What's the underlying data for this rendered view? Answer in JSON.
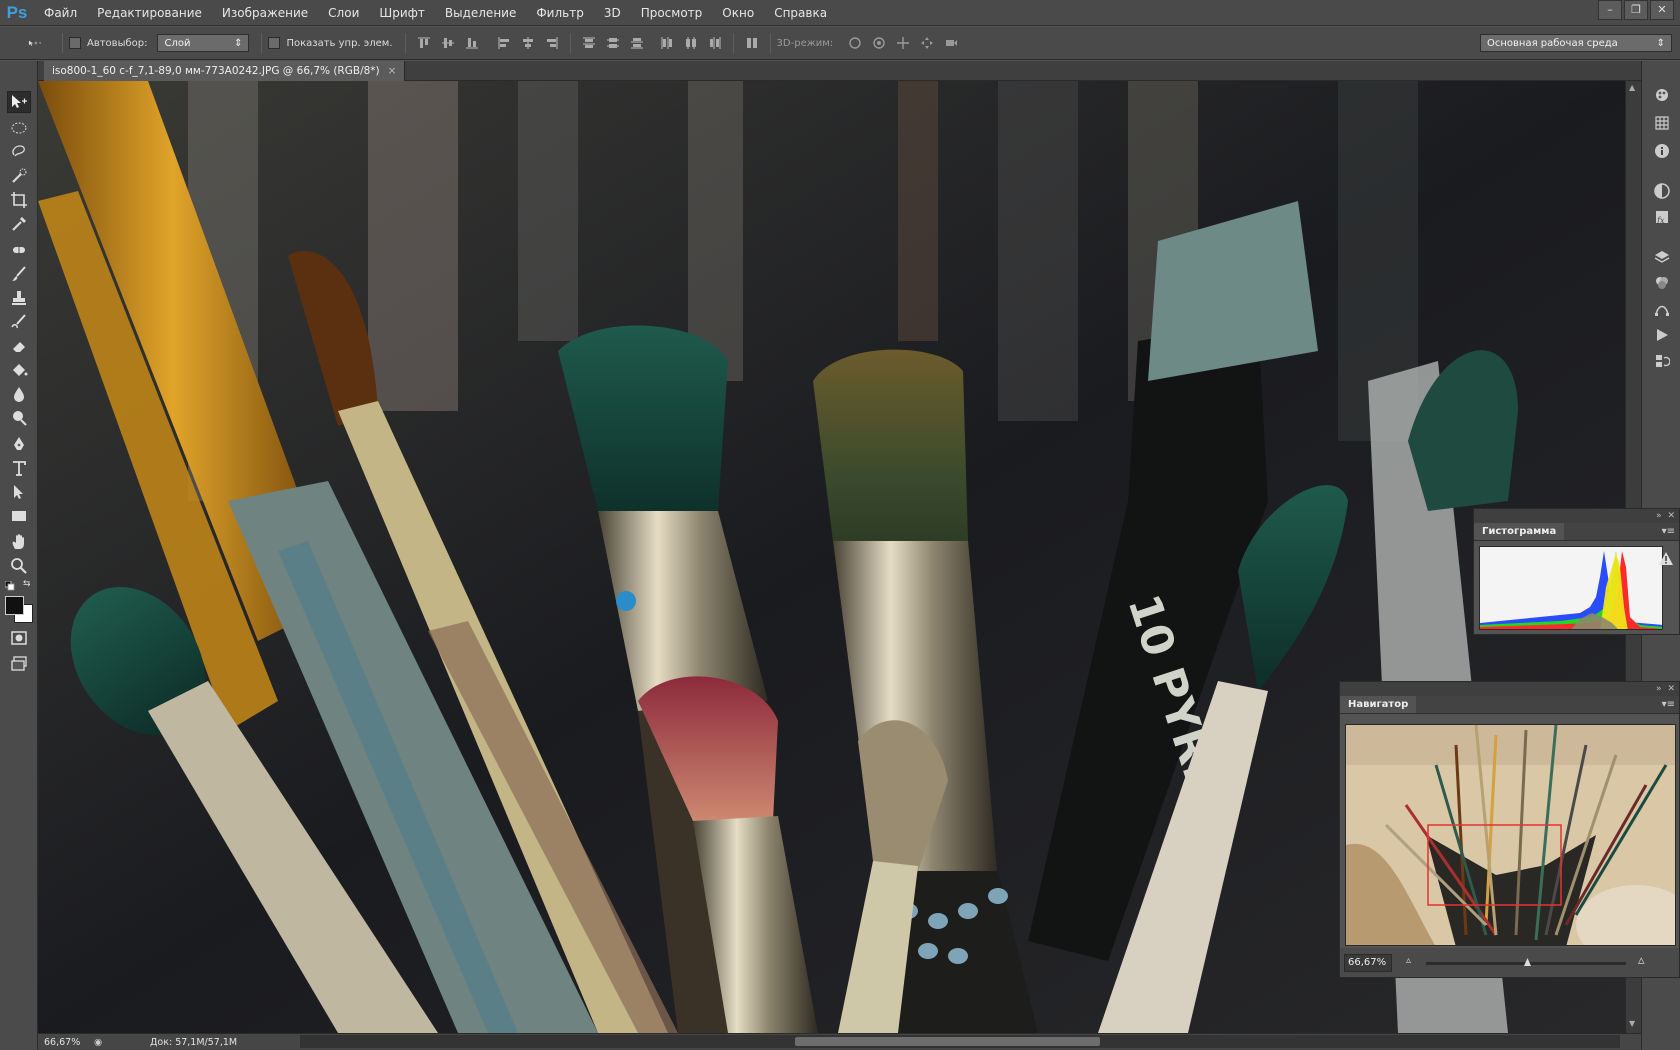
{
  "app": {
    "logo": "Ps"
  },
  "menu": [
    "Файл",
    "Редактирование",
    "Изображение",
    "Слои",
    "Шрифт",
    "Выделение",
    "Фильтр",
    "3D",
    "Просмотр",
    "Окно",
    "Справка"
  ],
  "options": {
    "autoselect_label": "Автовыбор:",
    "autoselect_value": "Слой",
    "show_transform_label": "Показать упр. элем.",
    "mode3d_label": "3D-режим:",
    "workspace_value": "Основная рабочая среда"
  },
  "document": {
    "tab_title": "iso800-1_60 с-f_7,1-89,0 мм-773A0242.JPG @ 66,7% (RGB/8*)",
    "close_glyph": "×"
  },
  "status": {
    "zoom": "66,67%",
    "doc_info": "Док: 57,1M/57,1M"
  },
  "panels": {
    "histogram": {
      "tab": "Гистограмма",
      "warning_icon": "warning-icon"
    },
    "navigator": {
      "tab": "Навигатор",
      "zoom": "66,67%"
    }
  },
  "colors": {
    "accent": "#3d9fe0",
    "nav_view_box": "#e2342e",
    "foreground": "#111111",
    "background": "#ffffff"
  }
}
